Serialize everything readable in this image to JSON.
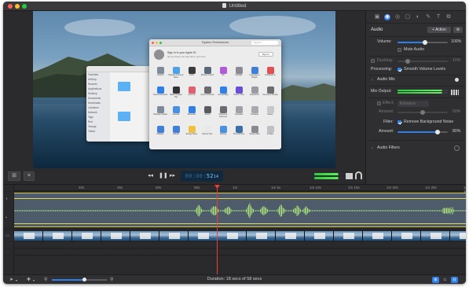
{
  "window": {
    "title": "Untitled"
  },
  "transport": {
    "timecode_dim": "00:00:",
    "timecode_bright": "52",
    "timecode_frames": "14",
    "rewind_icon": "rewind-icon",
    "pause_icon": "pause-icon",
    "forward_icon": "fast-forward-icon"
  },
  "inspector": {
    "section_audio": "Audio",
    "action_button": "Action",
    "volume_label": "Volume:",
    "volume_value": "100%",
    "volume_level": 0.55,
    "mute_label": "Mute Audio",
    "ducking_label": "Ducking:",
    "ducking_value": "10%",
    "ducking_level": 0.2,
    "processing_label": "Processing:",
    "smooth_label": "Smooth Volume Levels",
    "audio_mix_label": "Audio Mix",
    "mix_output_label": "Mix Output:",
    "effect_label": "Effect:",
    "effect_value": "Enhance",
    "amount_label": "Amount:",
    "amount_value": "50%",
    "amount_level": 0.5,
    "filter_label": "Filter:",
    "remove_noise_label": "Remove Background Noise",
    "amount2_label": "Amount:",
    "amount2_value": "80%",
    "amount2_level": 0.8,
    "audio_filters_label": "Audio Filters"
  },
  "prefs": {
    "title": "System Preferences",
    "search_placeholder": "Search",
    "signin_title": "Sign in to your Apple ID",
    "signin_sub": "Set up iCloud, the App Store, and more.",
    "signin_button": "Sign In",
    "items": [
      {
        "label": "General",
        "color": "#7d8a99"
      },
      {
        "label": "Desktop & Screen Saver",
        "color": "#4aa3e8"
      },
      {
        "label": "Dock",
        "color": "#3b3b3f"
      },
      {
        "label": "Mission Control",
        "color": "#5a6a7a"
      },
      {
        "label": "Siri",
        "color": "#b05ad8"
      },
      {
        "label": "Spotlight",
        "color": "#8a8a90"
      },
      {
        "label": "Language & Region",
        "color": "#3f7fd8"
      },
      {
        "label": "Notifications",
        "color": "#e05050"
      },
      {
        "label": "Internet Accounts",
        "color": "#2f7fe9"
      },
      {
        "label": "Wallet & Apple Pay",
        "color": "#333"
      },
      {
        "label": "Touch ID",
        "color": "#e05f70"
      },
      {
        "label": "Users & Groups",
        "color": "#6b6b70"
      },
      {
        "label": "Accessibility",
        "color": "#2f7fe9"
      },
      {
        "label": "Screen Time",
        "color": "#6a4ed8"
      },
      {
        "label": "Extensions",
        "color": "#9a9aa0"
      },
      {
        "label": "Security & Privacy",
        "color": "#6b6b70"
      },
      {
        "label": "Software Update",
        "color": "#7d8a99"
      },
      {
        "label": "Network",
        "color": "#4a90e2"
      },
      {
        "label": "Bluetooth",
        "color": "#2f7fe9"
      },
      {
        "label": "Sound",
        "color": "#5a5a60"
      },
      {
        "label": "Printers & Scanners",
        "color": "#6b6b70"
      },
      {
        "label": "Keyboard",
        "color": "#a0a0a6"
      },
      {
        "label": "Trackpad",
        "color": "#a8a8ae"
      },
      {
        "label": "Mouse",
        "color": "#c8c8cc"
      },
      {
        "label": "Displays",
        "color": "#3f7fd8"
      },
      {
        "label": "Sidecar",
        "color": "#3f7fd8"
      },
      {
        "label": "Energy Saver",
        "color": "#f0c040"
      },
      {
        "label": "Date & Time",
        "color": "#e8e8ea"
      },
      {
        "label": "Sharing",
        "color": "#4a90e2"
      },
      {
        "label": "Time Machine",
        "color": "#3a6fa8"
      },
      {
        "label": "Startup Disk",
        "color": "#8a8a90"
      },
      {
        "label": "Profiles",
        "color": "#c0c0c4"
      }
    ]
  },
  "finder": {
    "sidebar": [
      "Favorites",
      "AirDrop",
      "Recents",
      "Applications",
      "Desktop",
      "Documents",
      "Downloads",
      "Locations",
      "Network",
      "Tags",
      "Red",
      "Orange",
      "Yellow"
    ]
  },
  "timeline": {
    "ticks": [
      "40s",
      "45s",
      "50s",
      "55s",
      "1m",
      "1m 5s",
      "1m 10s",
      "1m 15s",
      "1m 20s",
      "1m 25s",
      "1m 30s"
    ]
  },
  "status": {
    "duration_text": "Duration: 18 secs of 58 secs",
    "zoom_level": 0.6
  }
}
